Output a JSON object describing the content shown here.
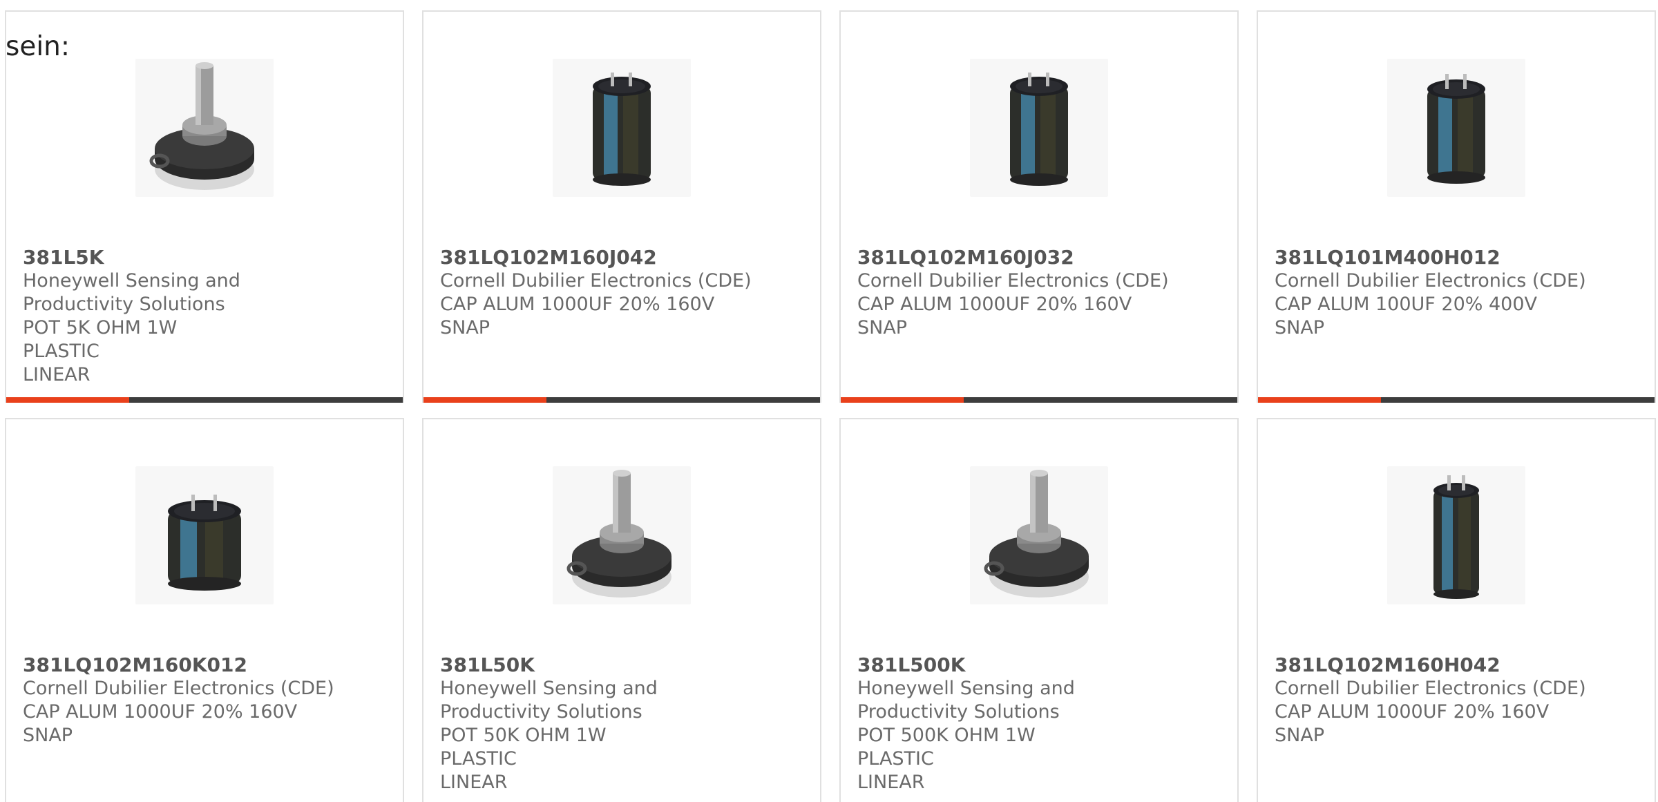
{
  "intro": {
    "text": "sein:"
  },
  "colors": {
    "accent": "#e9401b",
    "bar_track": "#3d3d3d",
    "text": "#6a6a6a",
    "border": "#e0e0e0"
  },
  "products": [
    {
      "part": "381L5K",
      "maker_lines": [
        "Honeywell Sensing and",
        "Productivity Solutions"
      ],
      "desc_lines": [
        "POT 5K OHM 1W PLASTIC",
        "LINEAR"
      ],
      "image": "potentiometer-icon",
      "bar_fill": 0.31
    },
    {
      "part": "381LQ102M160J042",
      "maker_lines": [
        "Cornell Dubilier Electronics (CDE)"
      ],
      "desc_lines": [
        "CAP ALUM 1000UF 20% 160V",
        "SNAP"
      ],
      "image": "capacitor-tall-icon",
      "bar_fill": 0.31
    },
    {
      "part": "381LQ102M160J032",
      "maker_lines": [
        "Cornell Dubilier Electronics (CDE)"
      ],
      "desc_lines": [
        "CAP ALUM 1000UF 20% 160V",
        "SNAP"
      ],
      "image": "capacitor-tall-icon",
      "bar_fill": 0.31
    },
    {
      "part": "381LQ101M400H012",
      "maker_lines": [
        "Cornell Dubilier Electronics (CDE)"
      ],
      "desc_lines": [
        "CAP ALUM 100UF 20% 400V",
        "SNAP"
      ],
      "image": "capacitor-tall-icon",
      "bar_fill": 0.31
    },
    {
      "part": "381LQ102M160K012",
      "maker_lines": [
        "Cornell Dubilier Electronics (CDE)"
      ],
      "desc_lines": [
        "CAP ALUM 1000UF 20% 160V",
        "SNAP"
      ],
      "image": "capacitor-short-icon",
      "bar_fill": 0.31
    },
    {
      "part": "381L50K",
      "maker_lines": [
        "Honeywell Sensing and",
        "Productivity Solutions"
      ],
      "desc_lines": [
        "POT 50K OHM 1W PLASTIC",
        "LINEAR"
      ],
      "image": "potentiometer-icon",
      "bar_fill": 0.31
    },
    {
      "part": "381L500K",
      "maker_lines": [
        "Honeywell Sensing and",
        "Productivity Solutions"
      ],
      "desc_lines": [
        "POT 500K OHM 1W PLASTIC",
        "LINEAR"
      ],
      "image": "potentiometer-icon",
      "bar_fill": 0.31
    },
    {
      "part": "381LQ102M160H042",
      "maker_lines": [
        "Cornell Dubilier Electronics (CDE)"
      ],
      "desc_lines": [
        "CAP ALUM 1000UF 20% 160V",
        "SNAP"
      ],
      "image": "capacitor-slim-icon",
      "bar_fill": 0.31
    }
  ]
}
